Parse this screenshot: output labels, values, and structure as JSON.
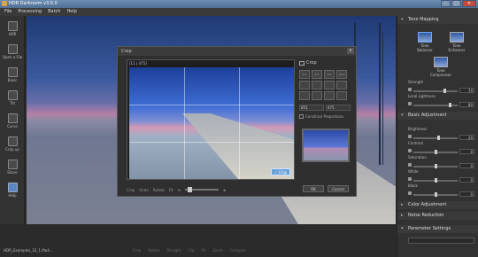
{
  "window": {
    "title": "HDR Darkroom v3.0.0",
    "min": "–",
    "max": "□",
    "close": "✕"
  },
  "menu": [
    "File",
    "Processing",
    "Batch",
    "Help"
  ],
  "toolbar": [
    {
      "name": "hdr",
      "label": "HDR"
    },
    {
      "name": "open-a-file",
      "label": "Open a File"
    },
    {
      "name": "basic",
      "label": "Basic"
    },
    {
      "name": "tilt",
      "label": "Tilt"
    },
    {
      "name": "curve",
      "label": "Curve"
    },
    {
      "name": "crop",
      "label": "Crop up"
    },
    {
      "name": "share",
      "label": "Share"
    },
    {
      "name": "help",
      "label": "Help"
    }
  ],
  "crop_dialog": {
    "title": "Crop",
    "close": "x",
    "dims": "[11 | 475]",
    "panel_label": "Crop",
    "ratios": [
      "1:1",
      "4:3",
      "3:2",
      "16:9",
      "",
      "",
      "",
      "",
      "",
      "",
      "",
      ""
    ],
    "width_value": "851",
    "height_value": "475",
    "keep_ratio_label": "Constrain Proportions",
    "crop_button": "Crop",
    "bottom_tools": [
      "Crop",
      "Undo",
      "Rotate",
      "Fit"
    ],
    "ok": "OK",
    "cancel": "Cancel"
  },
  "right_panel": {
    "tone_mapping": "Tone Mapping",
    "items": [
      {
        "label": "Tone Balancer",
        "selected": true
      },
      {
        "label": "Tone Enhancer",
        "selected": false
      },
      {
        "label": "Tone Compressor",
        "selected": false
      }
    ],
    "strength_label": "Strength",
    "strength_value": "70",
    "local_lightness_label": "Local Lightness",
    "local_lightness_value": "80",
    "basic_adjustment": "Basic Adjustment",
    "brightness_label": "Brightness",
    "brightness_value": "20",
    "contrast_label": "Contrast",
    "contrast_value": "0",
    "saturation_label": "Saturation",
    "saturation_value": "0",
    "white_label": "White",
    "white_value": "0",
    "black_label": "Black",
    "black_value": "0",
    "color_adjustment": "Color Adjustment",
    "noise_reduction": "Noise Reduction",
    "parameter_settings": "Parameter Settings"
  },
  "status": {
    "filename": "HDR_Examples_32_1.tfw4...",
    "tools": [
      "Crop",
      "Rotate",
      "Straight",
      "Flip",
      "Fit",
      "Zoom",
      "Compare"
    ]
  },
  "colors": {
    "accent": "#6aa0d8",
    "panel": "#323232",
    "titlebar": "#5a7aa0"
  }
}
